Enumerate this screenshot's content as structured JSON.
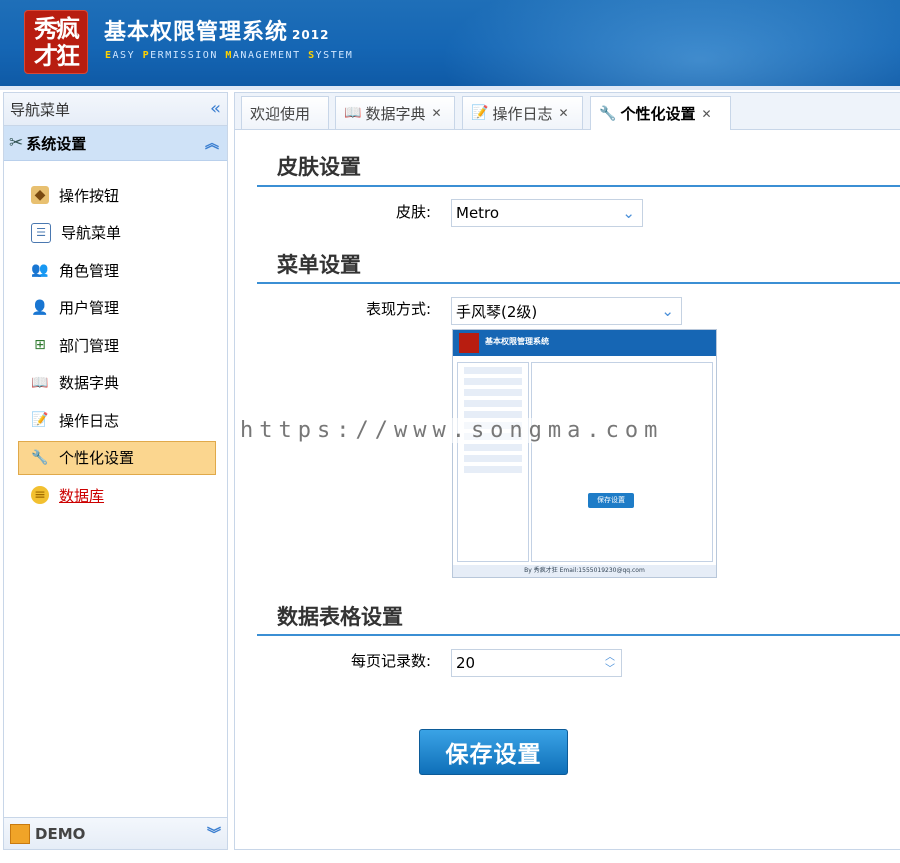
{
  "header": {
    "logo_text": "秀疯才狂",
    "title": "基本权限管理系统",
    "year": "2012",
    "subtitle_parts": [
      "E",
      "ASY ",
      "P",
      "ERMISSION ",
      "M",
      "ANAGEMENT ",
      "S",
      "YSTEM"
    ]
  },
  "sidebar": {
    "title": "导航菜单",
    "group_title": "系统设置",
    "items": [
      {
        "label": "操作按钮",
        "icon": "buttons-icon"
      },
      {
        "label": "导航菜单",
        "icon": "menu-icon"
      },
      {
        "label": "角色管理",
        "icon": "roles-icon"
      },
      {
        "label": "用户管理",
        "icon": "users-icon"
      },
      {
        "label": "部门管理",
        "icon": "department-icon"
      },
      {
        "label": "数据字典",
        "icon": "dictionary-icon"
      },
      {
        "label": "操作日志",
        "icon": "log-icon"
      },
      {
        "label": "个性化设置",
        "icon": "wrench-icon",
        "active": true
      },
      {
        "label": "数据库",
        "icon": "database-icon",
        "link": true
      }
    ],
    "footer_label": "DEMO"
  },
  "tabs": [
    {
      "label": "欢迎使用"
    },
    {
      "label": "数据字典",
      "closable": true
    },
    {
      "label": "操作日志",
      "closable": true
    },
    {
      "label": "个性化设置",
      "closable": true,
      "active": true
    }
  ],
  "skin_section": {
    "title": "皮肤设置",
    "label": "皮肤:",
    "value": "Metro"
  },
  "menu_section": {
    "title": "菜单设置",
    "label": "表现方式:",
    "value": "手风琴(2级)",
    "preview": {
      "title": "基本权限管理系统",
      "save_label": "保存设置",
      "footer": "By 秀疯才狂 Email:1555019230@qq.com"
    }
  },
  "grid_section": {
    "title": "数据表格设置",
    "label": "每页记录数:",
    "value": "20"
  },
  "save_button": "保存设置",
  "watermark": "https://www.songma.com",
  "colors": {
    "header_blue": "#1566b4",
    "accent_blue": "#3b8fd4",
    "active_item": "#fbd68f",
    "link_red": "#cc0000"
  }
}
